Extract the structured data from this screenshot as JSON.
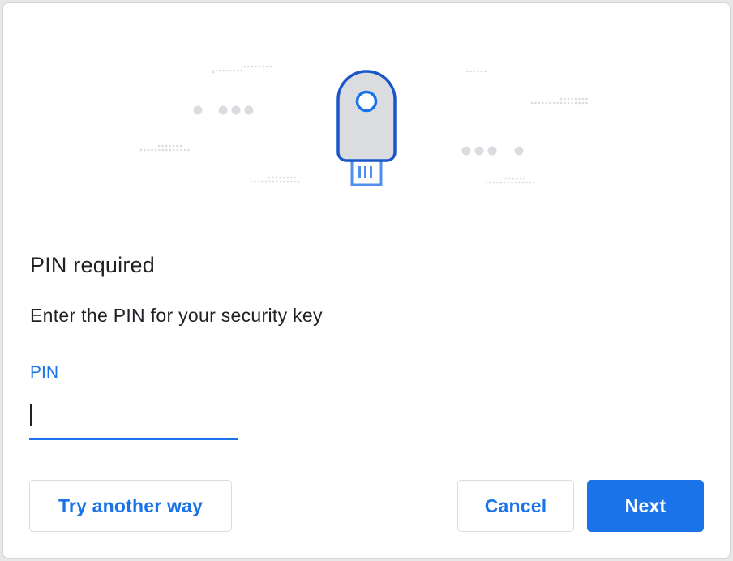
{
  "dialog": {
    "title": "PIN required",
    "description": "Enter the PIN for your security key",
    "pin_field": {
      "label": "PIN",
      "value": "",
      "placeholder": ""
    },
    "buttons": {
      "try_another_way": "Try another way",
      "cancel": "Cancel",
      "next": "Next"
    }
  },
  "illustration": {
    "icon": "security-key-icon",
    "dots_color": "#dadce0",
    "key_outline_color": "#1a56c8",
    "key_fill_color": "#dadce0",
    "connector_color": "#4e8ff0"
  },
  "colors": {
    "accent": "#1a73e8",
    "text": "#202124",
    "border": "#dadce0"
  }
}
